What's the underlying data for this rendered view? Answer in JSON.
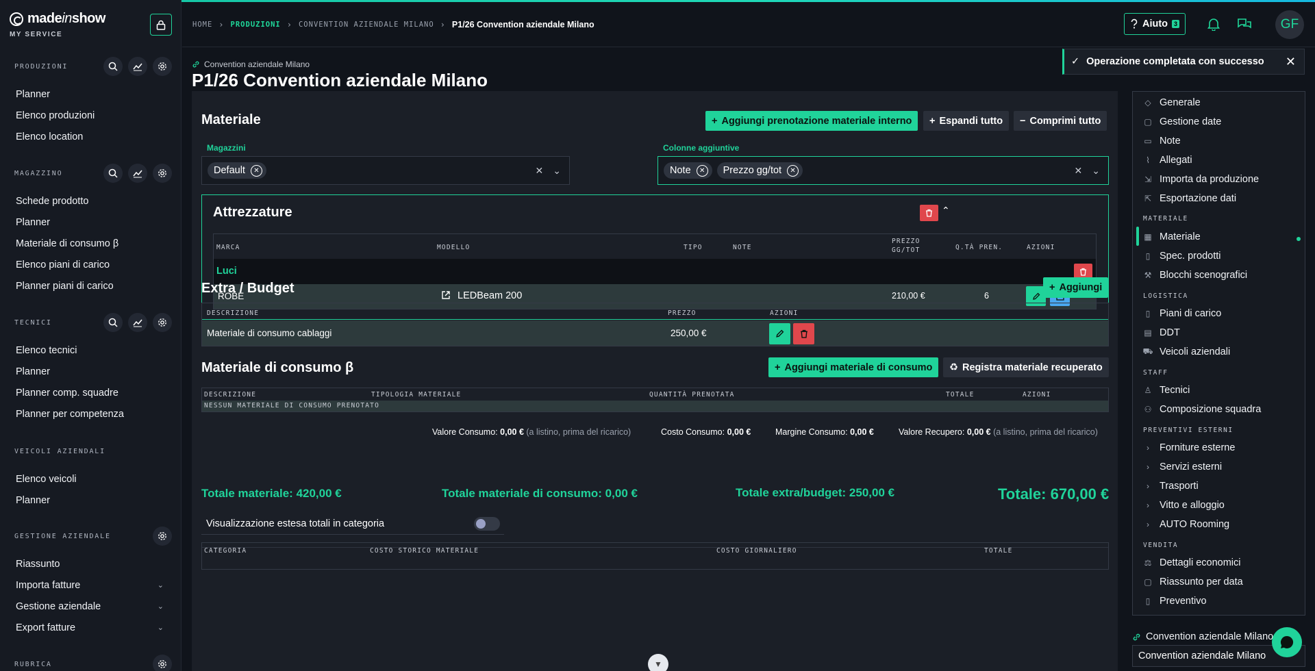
{
  "brand": {
    "name_prefix": "made",
    "name_accent": "in",
    "name_suffix": "show",
    "sub": "MY SERVICE"
  },
  "sidebar": {
    "sections": [
      {
        "label": "PRODUZIONI",
        "items": [
          "Planner",
          "Elenco produzioni",
          "Elenco location"
        ]
      },
      {
        "label": "MAGAZZINO",
        "items": [
          "Schede prodotto",
          "Planner",
          "Materiale di consumo β",
          "Elenco piani di carico",
          "Planner piani di carico"
        ]
      },
      {
        "label": "TECNICI",
        "items": [
          "Elenco tecnici",
          "Planner",
          "Planner comp. squadre",
          "Planner per competenza"
        ]
      },
      {
        "label": "VEICOLI AZIENDALI",
        "items": [
          "Elenco veicoli",
          "Planner"
        ]
      },
      {
        "label": "GESTIONE AZIENDALE",
        "items": [
          "Riassunto",
          "Importa fatture",
          "Gestione aziendale",
          "Export fatture"
        ]
      },
      {
        "label": "RUBRICA",
        "items": []
      }
    ]
  },
  "breadcrumb": {
    "home": "HOME",
    "produzioni": "PRODUZIONI",
    "convention": "CONVENTION AZIENDALE MILANO",
    "current": "P1/26 Convention aziendale Milano"
  },
  "header": {
    "help_label": "Aiuto",
    "help_badge": "3",
    "avatar": "GF"
  },
  "toast": {
    "message": "Operazione completata con successo"
  },
  "page": {
    "subtitle": "Convention aziendale Milano",
    "title": "P1/26 Convention aziendale Milano"
  },
  "materiale": {
    "title": "Materiale",
    "btn_add_internal": "Aggiungi prenotazione materiale interno",
    "btn_expand": "Espandi tutto",
    "btn_collapse": "Comprimi tutto",
    "magazzini_label": "Magazzini",
    "magazzini_chip": "Default",
    "colonne_label": "Colonne aggiuntive",
    "colonne_chips": [
      "Note",
      "Prezzo gg/tot"
    ]
  },
  "attrezzature": {
    "title": "Attrezzature",
    "headers": {
      "marca": "MARCA",
      "modello": "MODELLO",
      "tipo": "TIPO",
      "note": "NOTE",
      "prezzo_1": "PREZZO",
      "prezzo_2": "GG/TOT",
      "qta": "Q.TÀ PREN.",
      "azioni": "AZIONI"
    },
    "group": "Luci",
    "row": {
      "marca": "ROBE",
      "modello": "LEDBeam 200",
      "prezzo": "210,00 €",
      "qta": "6"
    }
  },
  "extra": {
    "title": "Extra / Budget",
    "btn_add": "Aggiungi",
    "headers": {
      "descrizione": "DESCRIZIONE",
      "prezzo": "PREZZO",
      "azioni": "AZIONI"
    },
    "row": {
      "descrizione": "Materiale di consumo cablaggi",
      "prezzo": "250,00 €"
    }
  },
  "consumo": {
    "title": "Materiale di consumo β",
    "btn_add": "Aggiungi materiale di consumo",
    "btn_register": "Registra materiale recuperato",
    "headers": {
      "descrizione": "DESCRIZIONE",
      "tipologia": "TIPOLOGIA MATERIALE",
      "quantita": "QUANTITÀ PRENOTATA",
      "totale": "TOTALE",
      "azioni": "AZIONI"
    },
    "empty": "NESSUN MATERIALE DI CONSUMO PRENOTATO",
    "summary": {
      "valore_label": "Valore Consumo:",
      "valore": "0,00 €",
      "valore_note": "(a listino, prima del ricarico)",
      "costo_label": "Costo Consumo:",
      "costo": "0,00 €",
      "margine_label": "Margine Consumo:",
      "margine": "0,00 €",
      "recupero_label": "Valore Recupero:",
      "recupero": "0,00 €",
      "recupero_note": "(a listino, prima del ricarico)"
    }
  },
  "totali": {
    "materiale": "Totale materiale: 420,00 €",
    "consumo": "Totale materiale di consumo: 0,00 €",
    "extra": "Totale extra/budget: 250,00 €",
    "totale": "Totale: 670,00 €",
    "toggle_label": "Visualizzazione estesa totali in categoria",
    "toggle_on": false
  },
  "bottom_table": {
    "categoria": "CATEGORIA",
    "costo_storico": "COSTO STORICO MATERIALE",
    "costo_giornaliero": "COSTO GIORNALIERO",
    "totale": "TOTALE"
  },
  "rightnav": {
    "items_top": [
      "Generale",
      "Gestione date",
      "Note",
      "Allegati",
      "Importa da produzione",
      "Esportazione dati"
    ],
    "materiale_head": "MATERIALE",
    "materiale_items": [
      "Materiale",
      "Spec. prodotti",
      "Blocchi scenografici"
    ],
    "logistica_head": "LOGISTICA",
    "logistica_items": [
      "Piani di carico",
      "DDT",
      "Veicoli aziendali"
    ],
    "staff_head": "STAFF",
    "staff_items": [
      "Tecnici",
      "Composizione squadra"
    ],
    "preventivi_head": "PREVENTIVI ESTERNI",
    "preventivi_items": [
      "Forniture esterne",
      "Servizi esterni",
      "Trasporti",
      "Vitto e alloggio",
      "AUTO Rooming"
    ],
    "vendita_head": "VENDITA",
    "vendita_items": [
      "Dettagli economici",
      "Riassunto per data",
      "Preventivo"
    ],
    "link_label": "Convention aziendale Milano",
    "input_value": "Convention aziendale Milano"
  },
  "colors": {
    "accent": "#20d39a",
    "danger": "#e0474c",
    "info": "#4aa8f0",
    "bg": "#10141b"
  }
}
